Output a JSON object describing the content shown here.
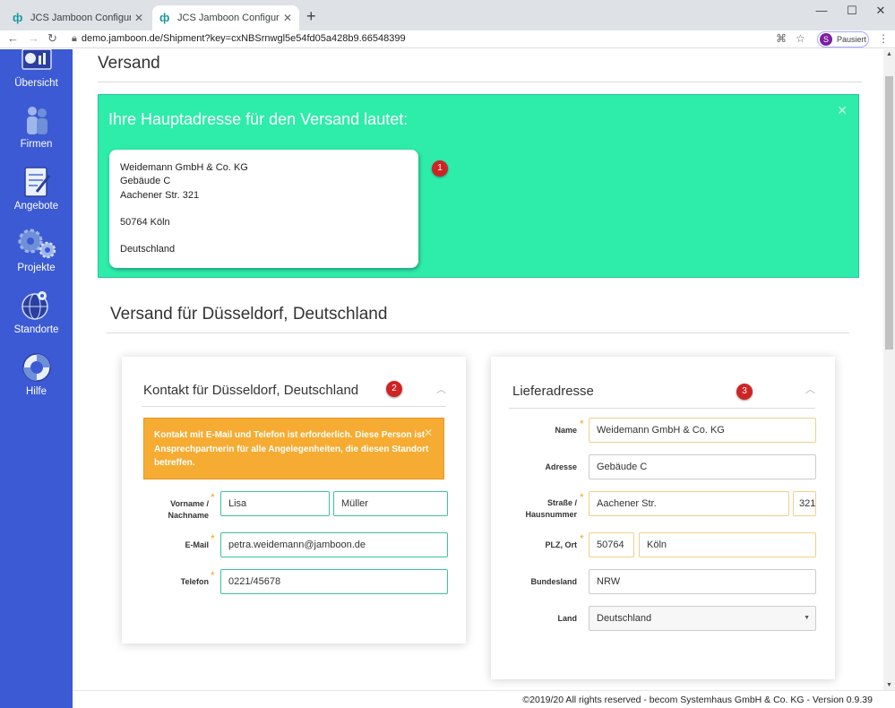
{
  "browser": {
    "tabs": [
      {
        "title": "JCS Jamboon Configuration Serv"
      },
      {
        "title": "JCS Jamboon Configuration Serv"
      }
    ],
    "url": "demo.jamboon.de/Shipment?key=cxNBSrnwgl5e54fd05a428b9.66548399",
    "profile_initial": "S",
    "profile_label": "Pausiert"
  },
  "sidebar": {
    "items": [
      {
        "label": "Übersicht",
        "icon": "dashboard-icon"
      },
      {
        "label": "Firmen",
        "icon": "people-icon"
      },
      {
        "label": "Angebote",
        "icon": "document-pen-icon"
      },
      {
        "label": "Projekte",
        "icon": "gears-icon"
      },
      {
        "label": "Standorte",
        "icon": "globe-pin-icon"
      },
      {
        "label": "Hilfe",
        "icon": "lifebuoy-icon"
      }
    ]
  },
  "page": {
    "title": "Versand",
    "main_address": {
      "heading": "Ihre Hauptadresse für den Versand lautet:",
      "lines": [
        "Weidemann GmbH & Co. KG",
        "Gebäude C",
        "Aachener Str. 321",
        "50764 Köln",
        "Deutschland"
      ],
      "badge": "1"
    },
    "subtitle": "Versand für Düsseldorf, Deutschland"
  },
  "contact_panel": {
    "title": "Kontakt für Düsseldorf, Deutschland",
    "badge": "2",
    "warning": "Kontakt mit E-Mail und Telefon ist erforderlich. Diese Person ist Ansprechpartnerin für alle Angelegenheiten, die diesen Standort betreffen.",
    "fields": {
      "name_label_1": "Vorname /",
      "name_label_2": "Nachname",
      "first_name": "Lisa",
      "last_name": "Müller",
      "email_label": "E-Mail",
      "email": "petra.weidemann@jamboon.de",
      "phone_label": "Telefon",
      "phone": "0221/45678"
    }
  },
  "delivery_panel": {
    "title": "Lieferadresse",
    "badge": "3",
    "fields": {
      "name_label": "Name",
      "name": "Weidemann GmbH & Co. KG",
      "address_label": "Adresse",
      "address": "Gebäude C",
      "street_label_1": "Straße /",
      "street_label_2": "Hausnummer",
      "street": "Aachener Str.",
      "house_no": "321",
      "zip_label": "PLZ, Ort",
      "zip": "50764",
      "city": "Köln",
      "state_label": "Bundesland",
      "state": "NRW",
      "country_label": "Land",
      "country": "Deutschland"
    }
  },
  "footer": {
    "text": "©2019/20 All rights reserved - becom Systemhaus GmbH & Co. KG - Version 0.9.39"
  },
  "colors": {
    "sidebar": "#3c5ad4",
    "alert_green": "#2eecaa",
    "warning_orange": "#f6ac32",
    "badge_red": "#cf2424"
  }
}
